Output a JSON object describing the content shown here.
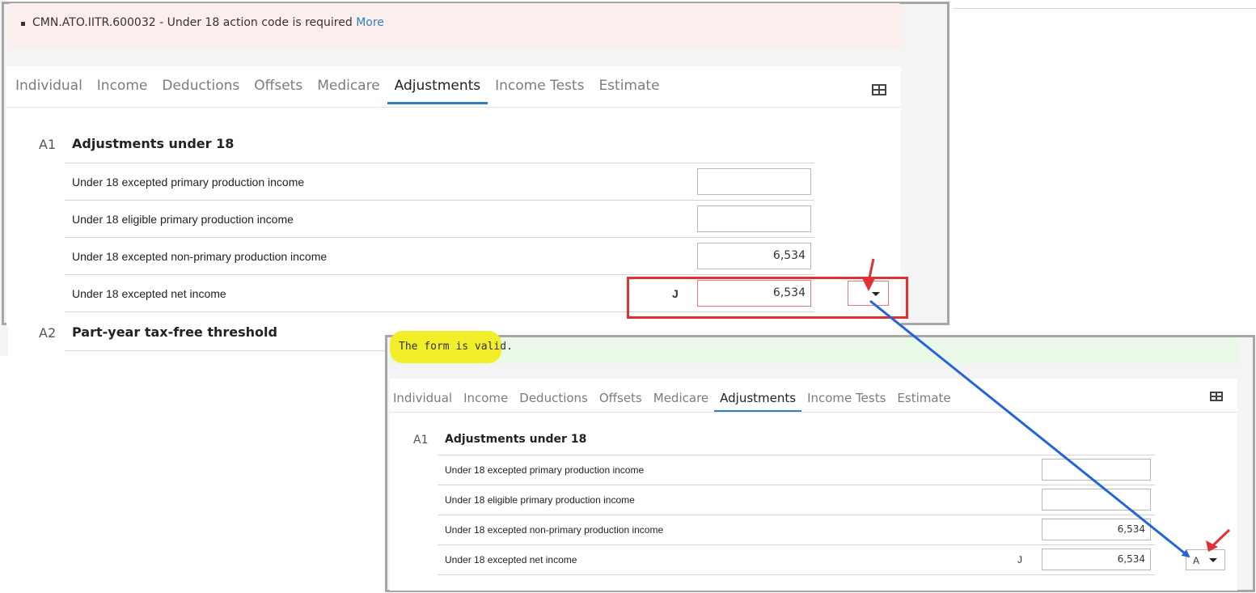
{
  "error_banner": {
    "code_text": "CMN.ATO.IITR.600032 - Under 18 action code is required",
    "more_link": "More"
  },
  "tabs": [
    "Individual",
    "Income",
    "Deductions",
    "Offsets",
    "Medicare",
    "Adjustments",
    "Income Tests",
    "Estimate"
  ],
  "active_tab": "Adjustments",
  "section_a1": {
    "code": "A1",
    "title": "Adjustments under 18",
    "rows": [
      {
        "label": "Under 18 excepted primary production income",
        "value": ""
      },
      {
        "label": "Under 18 eligible primary production income",
        "value": ""
      },
      {
        "label": "Under 18 excepted non-primary production income",
        "value": "6,534"
      },
      {
        "label": "Under 18 excepted net income",
        "value": "6,534",
        "code": "J"
      }
    ]
  },
  "section_a2": {
    "code": "A2",
    "title": "Part-year tax-free threshold"
  },
  "valid_message": "The form is valid.",
  "action_code_selected": "A",
  "colors": {
    "accent_blue": "#2f7ec4",
    "error_red": "#e03232",
    "valid_green_bg": "#eaf8e8",
    "highlight_yellow": "#f2ef2a",
    "arrow_blue": "#2563d8"
  }
}
